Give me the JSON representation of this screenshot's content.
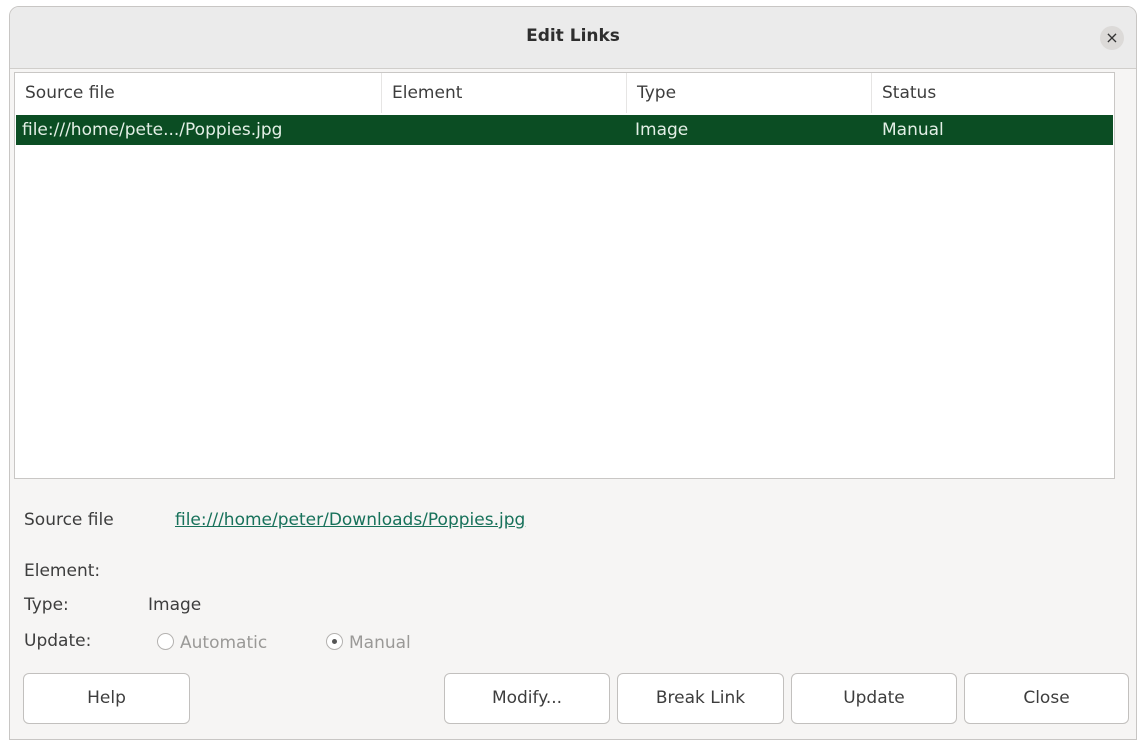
{
  "dialog": {
    "title": "Edit Links",
    "close_glyph": "×"
  },
  "list": {
    "columns": [
      "Source file",
      "Element",
      "Type",
      "Status"
    ],
    "rows": [
      {
        "source": "file:///home/pete.../Poppies.jpg",
        "element": "",
        "type": "Image",
        "status": "Manual"
      }
    ],
    "selected_color": "#0b4d23"
  },
  "details": {
    "source_label": "Source file",
    "source_value": "file:///home/peter/Downloads/Poppies.jpg",
    "element_label": "Element:",
    "element_value": "",
    "type_label": "Type:",
    "type_value": "Image",
    "update_label": "Update:",
    "update_options": {
      "automatic": "Automatic",
      "manual": "Manual"
    },
    "update_selected": "Manual"
  },
  "buttons": {
    "help": "Help",
    "modify": "Modify...",
    "break_link": "Break Link",
    "update": "Update",
    "close": "Close"
  },
  "colors": {
    "link": "#17715a",
    "selection": "#0b4d23"
  }
}
